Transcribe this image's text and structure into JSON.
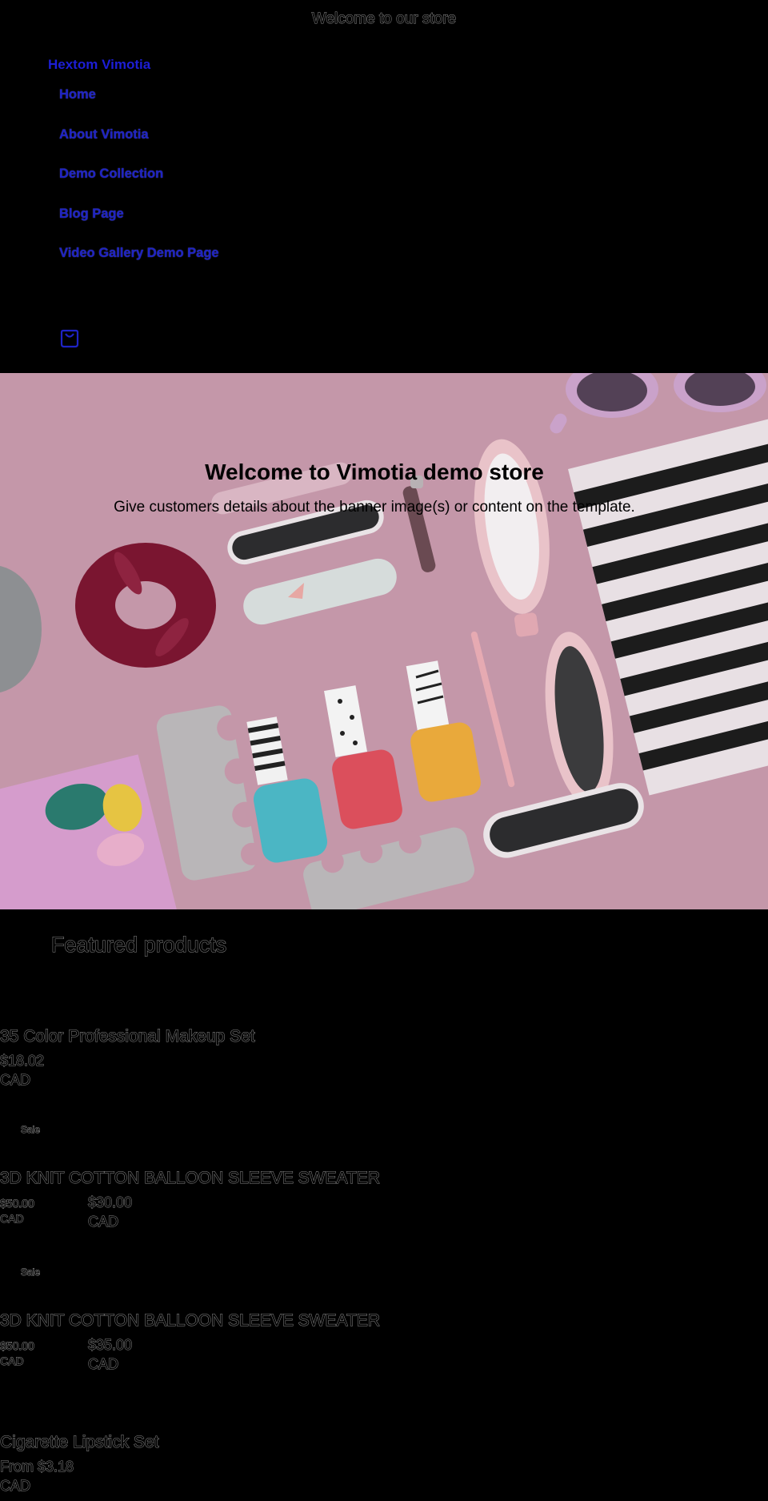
{
  "announcement": "Welcome to our store",
  "brand": "Hextom Vimotia",
  "nav": [
    {
      "label": "Home"
    },
    {
      "label": "About Vimotia"
    },
    {
      "label": "Demo Collection"
    },
    {
      "label": "Blog Page"
    },
    {
      "label": "Video Gallery Demo Page"
    }
  ],
  "cart_icon": "cart-icon",
  "hero": {
    "title": "Welcome to Vimotia demo store",
    "subtitle": "Give customers details about the banner image(s) or content on the template."
  },
  "featured": {
    "heading": "Featured products",
    "products": [
      {
        "title": "35 Color Professional Makeup Set",
        "price": "$18.02",
        "currency": "CAD"
      },
      {
        "badge": "Sale",
        "title": "3D KNIT COTTON BALLOON SLEEVE SWEATER",
        "compare_price": "$50.00",
        "compare_currency": "CAD",
        "price": "$30.00",
        "currency": "CAD"
      },
      {
        "badge": "Sale",
        "title": "3D KNIT COTTON BALLOON SLEEVE SWEATER",
        "compare_price": "$50.00",
        "compare_currency": "CAD",
        "price": "$35.00",
        "currency": "CAD"
      },
      {
        "title": "Cigarette Lipstick Set",
        "price": "From $3.18",
        "currency": "CAD"
      }
    ]
  },
  "colors": {
    "background": "#000000",
    "link": "#1e23c4",
    "hero_bg": "#c79aaa"
  }
}
